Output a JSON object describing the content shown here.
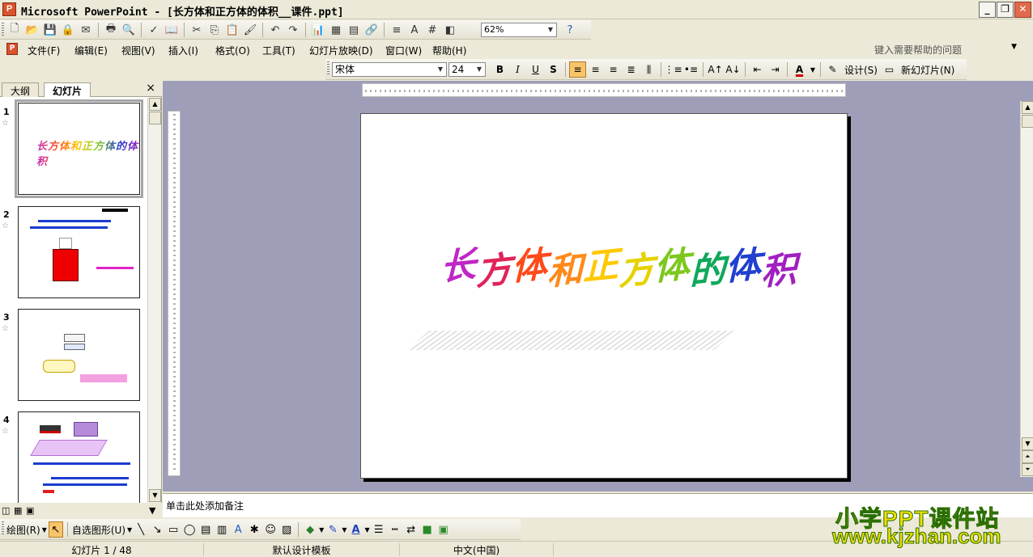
{
  "window": {
    "title": "Microsoft PowerPoint - [长方体和正方体的体积__课件.ppt]",
    "app_icon_label": "P"
  },
  "toolbar_standard": {
    "zoom": "62%"
  },
  "menus": {
    "items": [
      "文件(F)",
      "编辑(E)",
      "视图(V)",
      "插入(I)",
      "格式(O)",
      "工具(T)",
      "幻灯片放映(D)",
      "窗口(W)",
      "帮助(H)"
    ],
    "help_placeholder": "键入需要帮助的问题"
  },
  "format_toolbar": {
    "font": "宋体",
    "size": "24",
    "design_label": "设计(S)",
    "new_slide_label": "新幻灯片(N)"
  },
  "slide_pane": {
    "tab_outline": "大纲",
    "tab_slides": "幻灯片",
    "slides": [
      {
        "num": "1"
      },
      {
        "num": "2"
      },
      {
        "num": "3"
      },
      {
        "num": "4"
      }
    ]
  },
  "main_slide": {
    "wordart_chars": [
      "长",
      "方",
      "体",
      "和",
      "正",
      "方",
      "体",
      "的",
      "体",
      "积"
    ],
    "wordart_colors": [
      "#c026c6",
      "#e0245a",
      "#ff4a1a",
      "#ff8a1a",
      "#ffc800",
      "#e6d200",
      "#7cc81e",
      "#10a85c",
      "#2040d0",
      "#a020c0"
    ]
  },
  "notes": {
    "placeholder": "单击此处添加备注"
  },
  "draw_toolbar": {
    "draw_label": "绘图(R)",
    "autoshapes_label": "自选图形(U)"
  },
  "status": {
    "slide_info": "幻灯片 1 / 48",
    "template": "默认设计模板",
    "language": "中文(中国)"
  },
  "watermark": {
    "line1": "小学PPT课件站",
    "line2": "www.kjzhan.com"
  }
}
